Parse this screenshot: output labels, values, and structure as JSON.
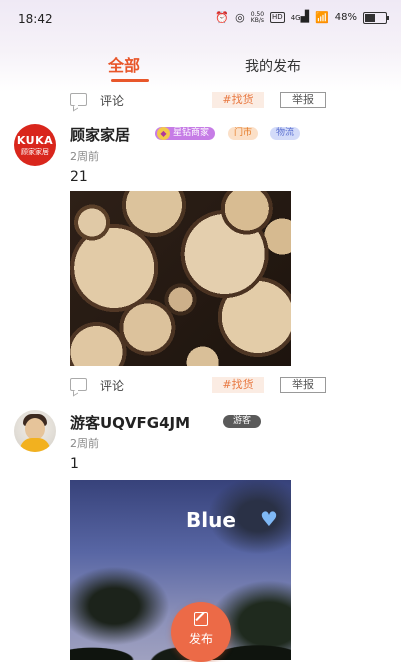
{
  "status_bar": {
    "time": "18:42",
    "speed": "0.50",
    "speed_unit": "KB/s",
    "hd_tag": "HD",
    "network": "4G",
    "battery": "48%",
    "battery_level": 0.48
  },
  "tabs": [
    {
      "label": "全部",
      "active": true
    },
    {
      "label": "我的发布",
      "active": false
    }
  ],
  "action_labels": {
    "comment": "评论",
    "topic": "#找货",
    "report": "举报"
  },
  "partial_top": {
    "comment": "评论"
  },
  "posts": [
    {
      "author": "顾家家居",
      "avatar_text": "KUKA",
      "avatar_sub": "顾家家居",
      "badges": [
        "星钻商家",
        "门市",
        "物流"
      ],
      "time": "2周前",
      "content": "21",
      "image": "stacked-logs-photo"
    },
    {
      "author": "游客UQVFG4JM",
      "badges": [
        "游客"
      ],
      "time": "2周前",
      "content": "1",
      "image": "night-sky-photo",
      "image_text": "Blue"
    }
  ],
  "fab": {
    "label": "发布"
  },
  "colors": {
    "accent": "#e8562a",
    "fab": "#ec6a47",
    "tag_bg": "#fbece3",
    "diamond_badge": "#c67ce6",
    "store_badge": "#e57a25",
    "logistics_badge": "#5a6fd0"
  }
}
